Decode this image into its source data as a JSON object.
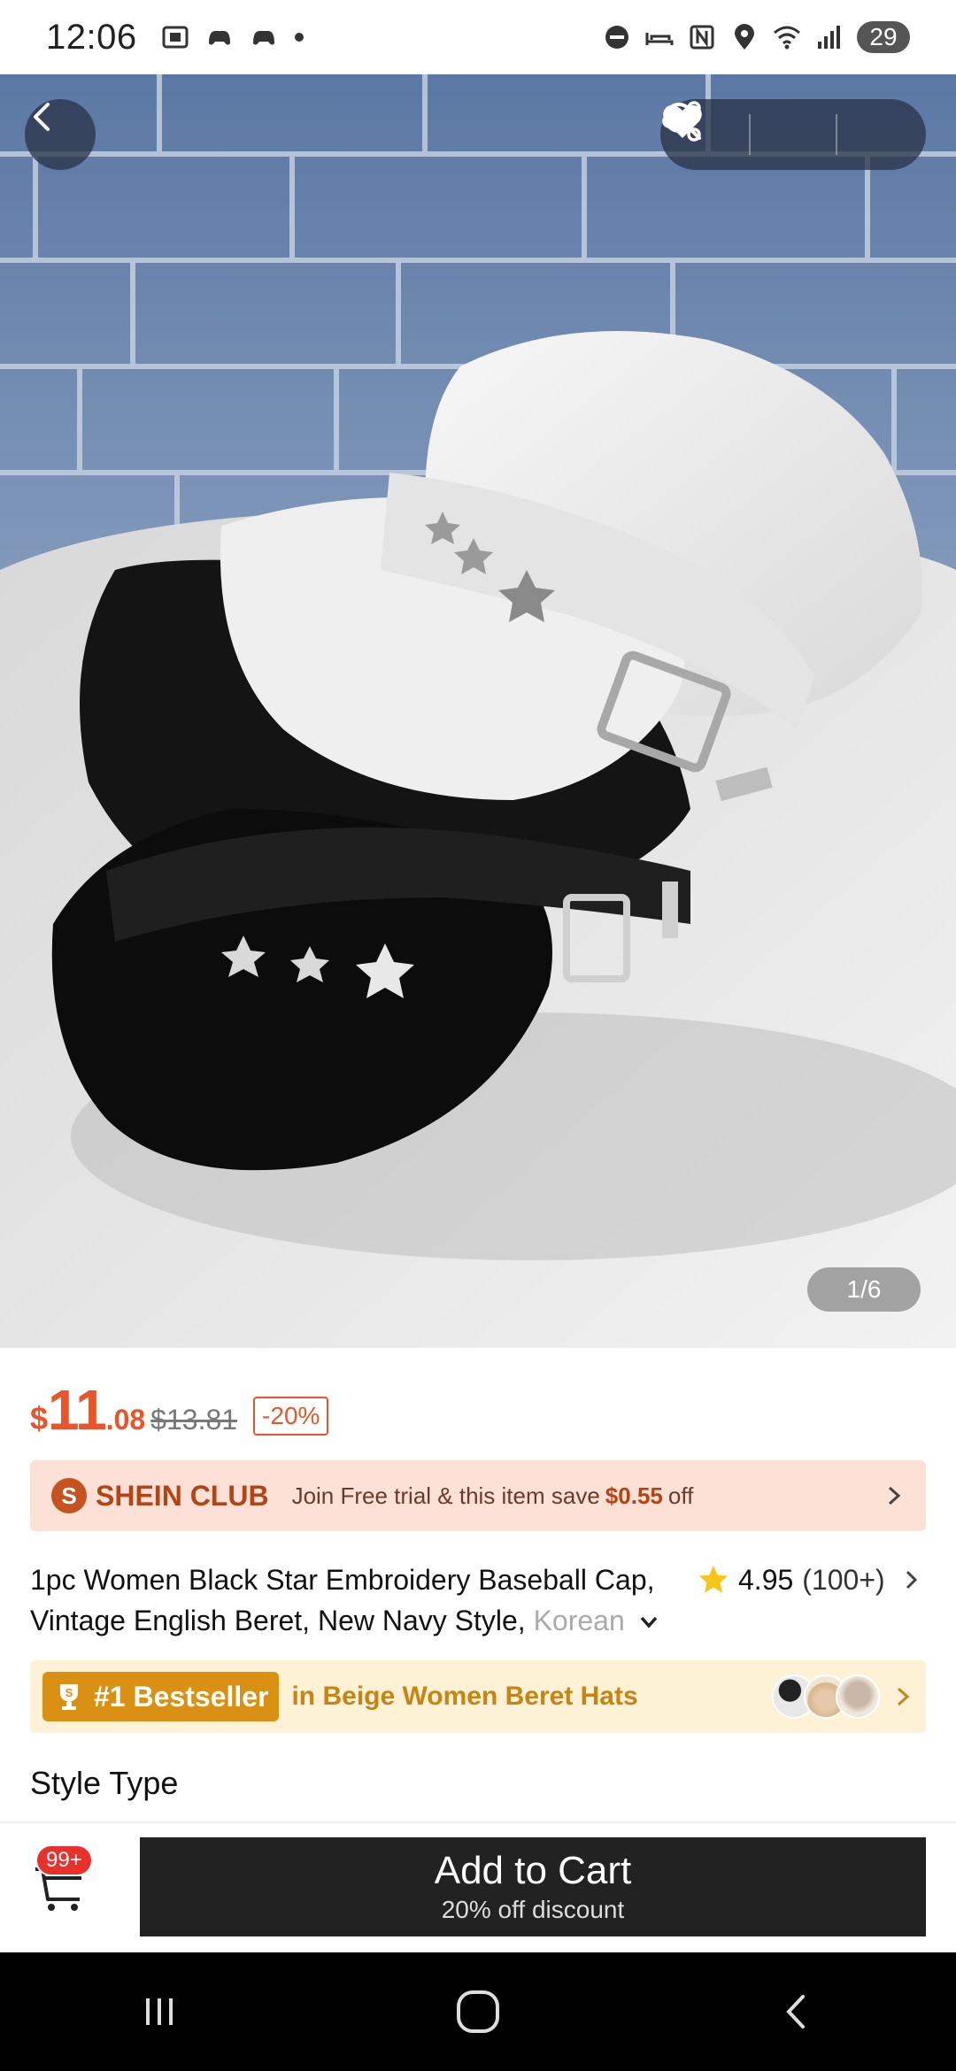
{
  "status_bar": {
    "time": "12:06",
    "battery": "29",
    "left_icons": [
      "screenshot-icon",
      "game-icon",
      "game-icon",
      "dot-icon"
    ],
    "right_icons": [
      "dnd-icon",
      "sleep-icon",
      "nfc-icon",
      "location-icon",
      "wifi-icon",
      "signal-icon"
    ]
  },
  "hero": {
    "counter": "1/6",
    "icons": [
      "back-icon",
      "search-icon",
      "heart-icon",
      "share-icon"
    ]
  },
  "price": {
    "currency": "$",
    "integer": "11",
    "decimal": ".08",
    "original": "$13.81",
    "discount": "-20%"
  },
  "club": {
    "logo_letter": "S",
    "name": "SHEIN CLUB",
    "text": "Join Free trial & this item save",
    "amount": "$0.55",
    "suffix": "off"
  },
  "product": {
    "title_main": "1pc Women Black Star Embroidery Baseball Cap, Vintage English Beret, New Navy Style,",
    "title_fade": "Korean",
    "rating": "4.95",
    "review_count": "(100+)"
  },
  "bestseller": {
    "tag": "#1 Bestseller",
    "text": "in Beige Women Beret Hats"
  },
  "section": {
    "style_type": "Style Type"
  },
  "bottom": {
    "cart_badge": "99+",
    "add_to_cart": "Add to Cart",
    "discount_note": "20% off discount"
  },
  "colors": {
    "price": "#e8552a",
    "club_bg": "#fde0d6",
    "bestseller_bg": "#fdf1d6",
    "bestseller_tag": "#d99013",
    "button": "#222222"
  }
}
